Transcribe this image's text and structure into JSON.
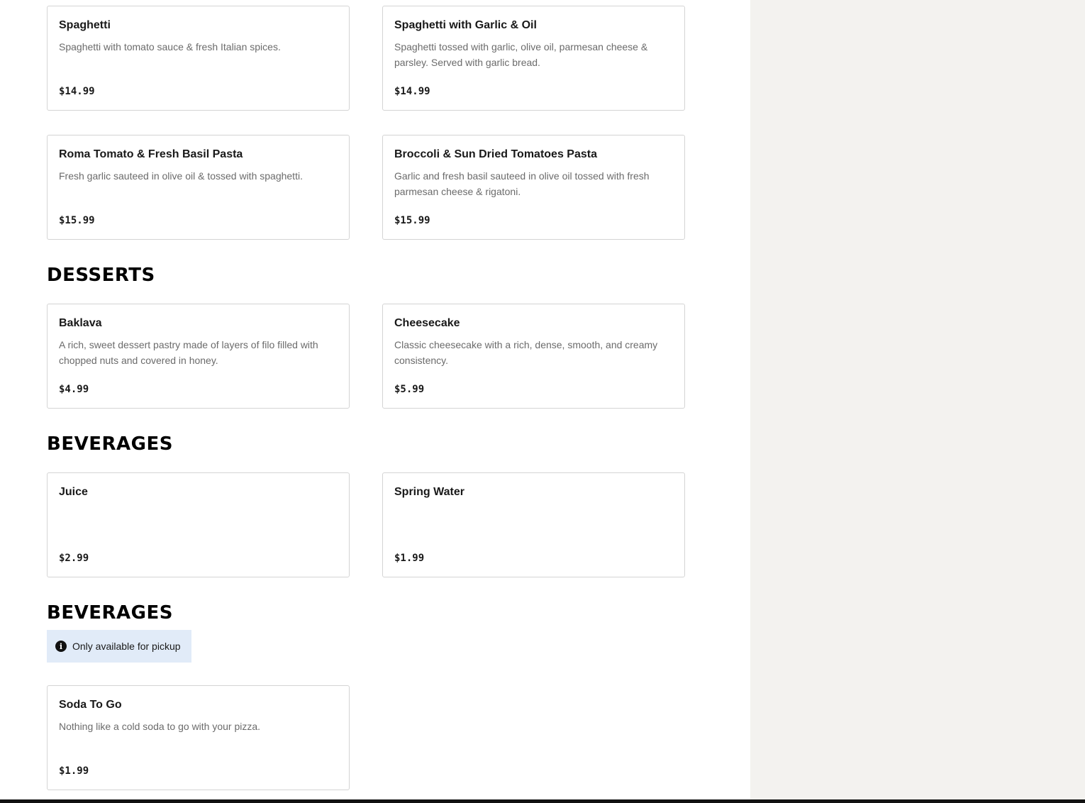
{
  "sections": [
    {
      "items": [
        {
          "name": "Spaghetti",
          "description": "Spaghetti with tomato sauce & fresh Italian spices.",
          "price": "$14.99"
        },
        {
          "name": "Spaghetti with Garlic & Oil",
          "description": "Spaghetti tossed with garlic, olive oil, parmesan cheese & parsley. Served with garlic bread.",
          "price": "$14.99"
        },
        {
          "name": "Roma Tomato & Fresh Basil Pasta",
          "description": "Fresh garlic sauteed in olive oil & tossed with spaghetti.",
          "price": "$15.99"
        },
        {
          "name": "Broccoli & Sun Dried Tomatoes Pasta",
          "description": "Garlic and fresh basil sauteed in olive oil tossed with fresh parmesan cheese & rigatoni.",
          "price": "$15.99"
        }
      ]
    },
    {
      "title": "DESSERTS",
      "items": [
        {
          "name": "Baklava",
          "description": "A rich, sweet dessert pastry made of layers of filo filled with chopped nuts and covered in honey.",
          "price": "$4.99"
        },
        {
          "name": "Cheesecake",
          "description": "Classic cheesecake with a rich, dense, smooth, and creamy consistency.",
          "price": "$5.99"
        }
      ]
    },
    {
      "title": "BEVERAGES",
      "items": [
        {
          "name": "Juice",
          "description": "",
          "price": "$2.99"
        },
        {
          "name": "Spring Water",
          "description": "",
          "price": "$1.99"
        }
      ]
    },
    {
      "title": "BEVERAGES",
      "notice": {
        "icon": "info-icon",
        "glyph": "i",
        "text": "Only available for pickup"
      },
      "items": [
        {
          "name": "Soda To Go",
          "description": "Nothing like a cold soda to go with your pizza.",
          "price": "$1.99"
        }
      ]
    }
  ],
  "colors": {
    "side_panel_bg": "#f3f2ef",
    "notice_bg": "#e1ebf8",
    "card_border": "#d4d4d4",
    "description_text": "#6b6b6b",
    "bottom_bar": "#111111"
  }
}
